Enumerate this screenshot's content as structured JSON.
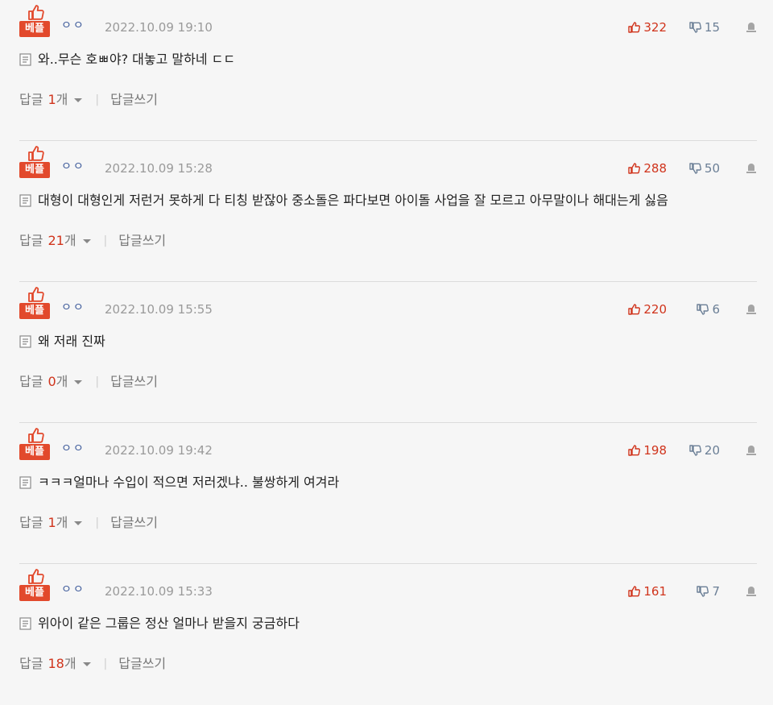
{
  "labels": {
    "best": "베플",
    "reply": "답글",
    "reply_unit": "개",
    "write_reply": "답글쓰기",
    "separator": "|"
  },
  "colors": {
    "best_badge": "#e2492c",
    "like": "#d0341c",
    "dislike": "#6b7f96",
    "author": "#3d5a9a",
    "date": "#9a9a9a"
  },
  "comments": [
    {
      "author": "ㅇㅇ",
      "date": "2022.10.09 19:10",
      "likes": "322",
      "dislikes": "15",
      "text": "와..무슨 호ㅃ야? 대놓고 말하네 ㄷㄷ",
      "reply_count": "1"
    },
    {
      "author": "ㅇㅇ",
      "date": "2022.10.09 15:28",
      "likes": "288",
      "dislikes": "50",
      "text": "대형이 대형인게 저런거 못하게 다 티칭 받잖아 중소돌은 파다보면 아이돌 사업을 잘 모르고 아무말이나 해대는게 싫음",
      "reply_count": "21"
    },
    {
      "author": "ㅇㅇ",
      "date": "2022.10.09 15:55",
      "likes": "220",
      "dislikes": "6",
      "text": "왜 저래 진짜",
      "reply_count": "0"
    },
    {
      "author": "ㅇㅇ",
      "date": "2022.10.09 19:42",
      "likes": "198",
      "dislikes": "20",
      "text": "ㅋㅋㅋ얼마나 수입이 적으면 저러겠냐.. 불쌍하게 여겨라",
      "reply_count": "1"
    },
    {
      "author": "ㅇㅇ",
      "date": "2022.10.09 15:33",
      "likes": "161",
      "dislikes": "7",
      "text": "위아이 같은 그룹은 정산 얼마나 받을지 궁금하다",
      "reply_count": "18"
    }
  ]
}
